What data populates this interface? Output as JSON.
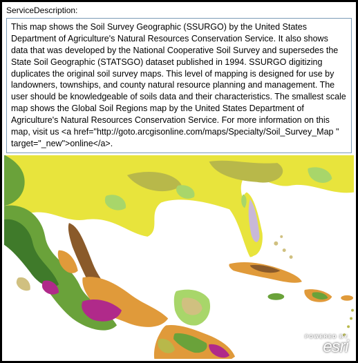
{
  "label": "ServiceDescription:",
  "description": "This map shows the Soil Survey Geographic (SSURGO) by the United States Department of Agriculture's Natural Resources Conservation Service.  It also shows data that was developed by the National Cooperative Soil Survey and supersedes the State Soil Geographic (STATSGO) dataset published in 1994.  SSURGO digitizing duplicates the original soil survey maps. This level of mapping is designed for use by landowners, townships, and county natural resource planning and management. The user should be knowledgeable of soils data and their characteristics.  The smallest scale map shows the Global Soil Regions map by the United States Department of Agriculture's Natural Resources Conservation Service.   For more information on this map, visit us <a href=\"http://goto.arcgisonline.com/maps/Specialty/Soil_Survey_Map \" target=\"_new\">online</a>.",
  "logo": {
    "powered": "POWERED BY",
    "brand": "esri"
  },
  "map": {
    "region": "Southern United States, Mexico, Central America, Caribbean",
    "theme": "Soil Survey Geographic (SSURGO) / Global Soil Regions",
    "legend_colors": {
      "yellow": "#e8e43c",
      "olive": "#b8b84a",
      "lightgreen": "#a8d66a",
      "midgreen": "#6aa23a",
      "darkgreen": "#3f7a2a",
      "brown": "#8a5a2a",
      "orange": "#e09a3a",
      "magenta": "#b02a8a",
      "lavender": "#c8b8d8",
      "tan": "#d0c080"
    }
  }
}
